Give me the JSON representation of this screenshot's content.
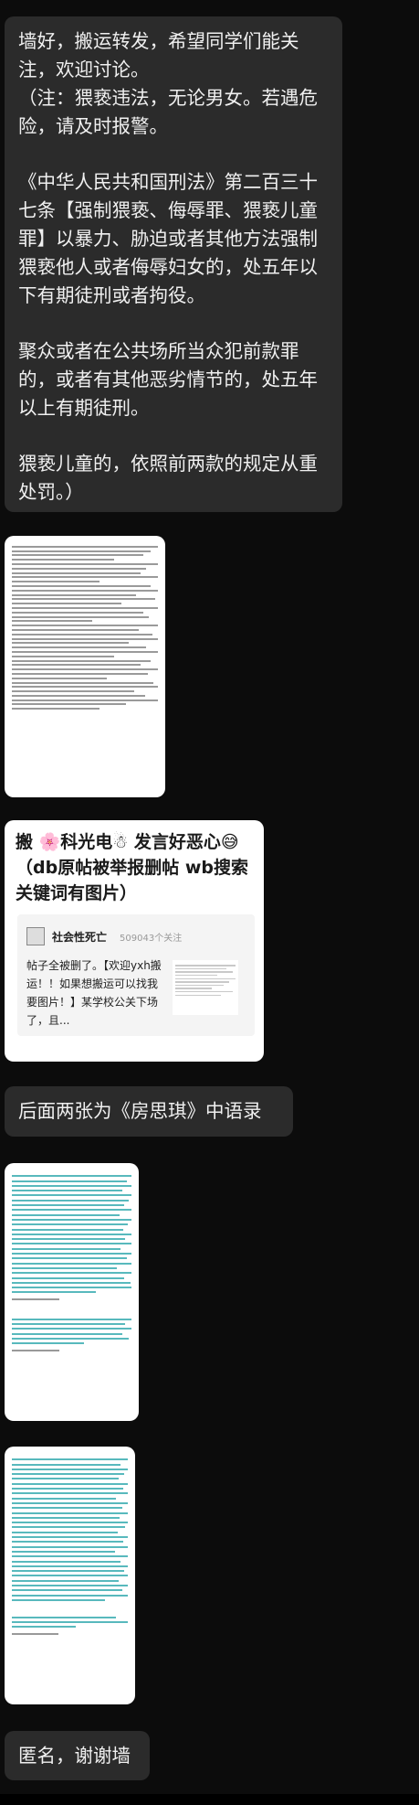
{
  "messages": {
    "msg1": {
      "line1": "墙好，搬运转发，希望同学们能关注，欢迎讨论。",
      "line2": "（注：猥亵违法，无论男女。若遇危险，请及时报警。",
      "para2": "《中华人民共和国刑法》第二百三十七条【强制猥亵、侮辱罪、猥亵儿童罪】以暴力、胁迫或者其他方法强制猥亵他人或者侮辱妇女的，处五年以下有期徒刑或者拘役。",
      "para3": "聚众或者在公共场所当众犯前款罪的，或者有其他恶劣情节的，处五年以上有期徒刑。",
      "para4": "猥亵儿童的，依照前两款的规定从重处罚。）"
    },
    "card": {
      "title": "搬 🌸科光电☃ 发言好恶心😅（db原帖被举报删帖 wb搜索关键词有图片）",
      "source_name": "社会性死亡",
      "source_count": "509043个关注",
      "body": "帖子全被删了。【欢迎yxh搬运！！如果想搬运可以找我要图片！】某学校公关下场了，且..."
    },
    "msg2": {
      "text": "后面两张为《房思琪》中语录"
    },
    "msg3": {
      "text": "匿名，谢谢墙"
    }
  }
}
